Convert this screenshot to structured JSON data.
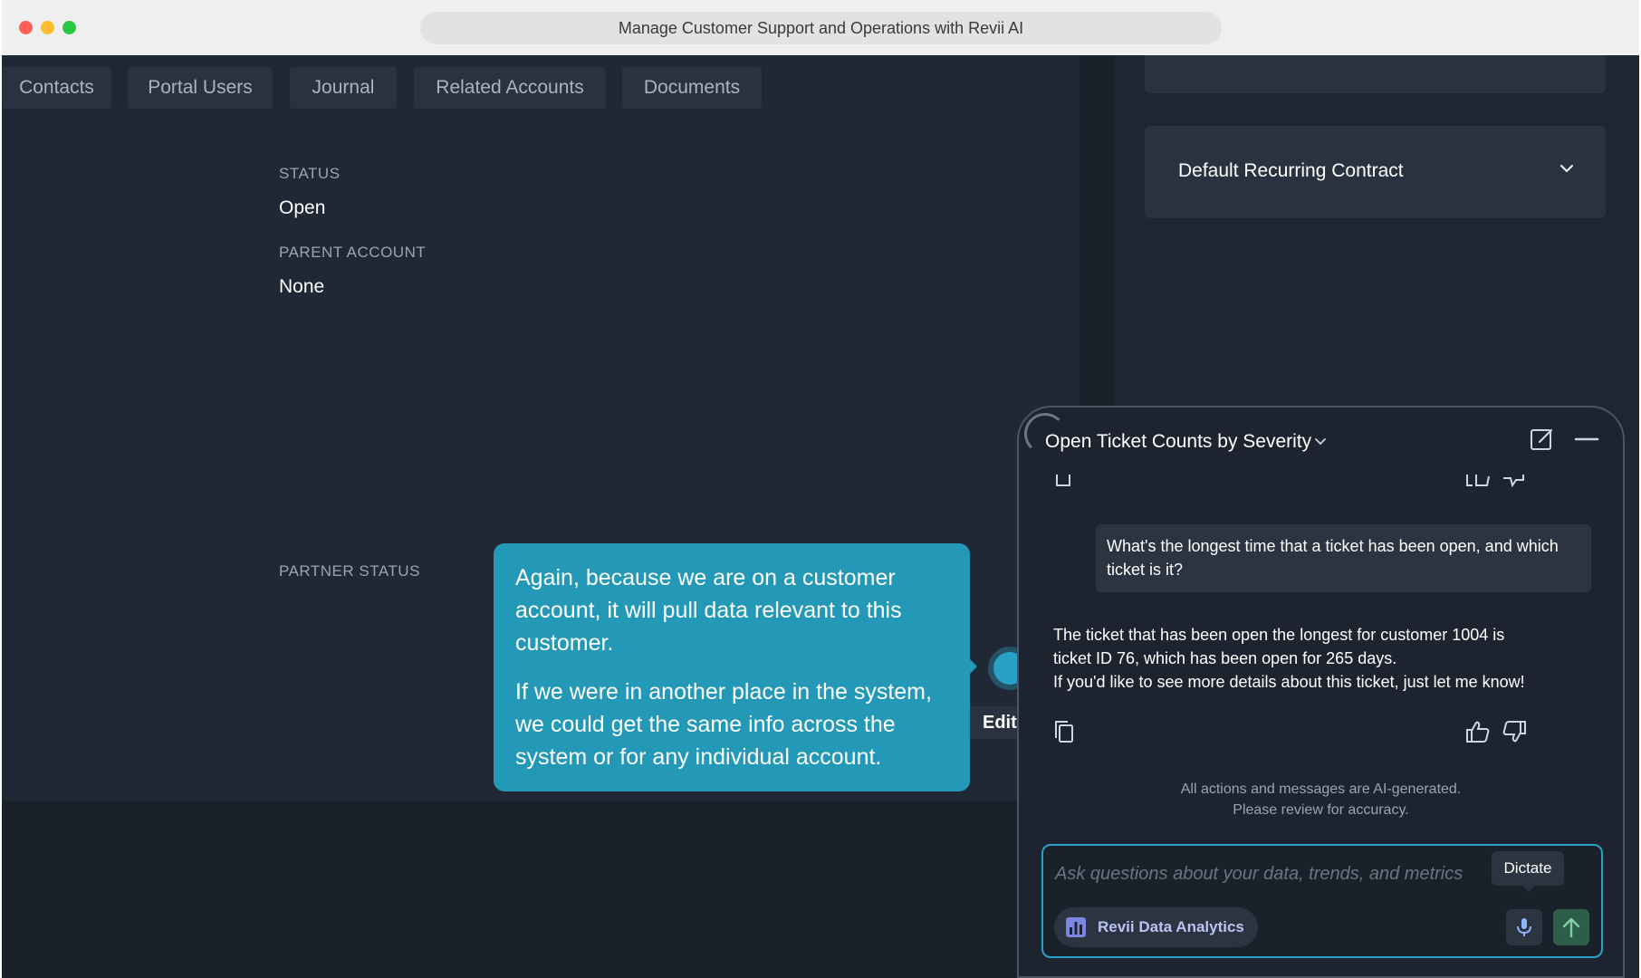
{
  "browser": {
    "title": "Manage Customer Support and Operations with Revii AI"
  },
  "tabs": [
    "Contacts",
    "Portal Users",
    "Journal",
    "Related Accounts",
    "Documents"
  ],
  "fields": {
    "status_label": "STATUS",
    "status_value": "Open",
    "parent_label": "PARENT ACCOUNT",
    "parent_value": "None",
    "partner_label": "PARTNER STATUS"
  },
  "right_panel": {
    "contract_title": "Default Recurring Contract"
  },
  "walkthrough": {
    "paragraph1": "Again, because we are on a customer account, it will pull data relevant to this customer.",
    "paragraph2": "If we were in another place in the system, we could get the same info across the system or for any individual account."
  },
  "edit_button": "Edit",
  "chat": {
    "title": "Open Ticket Counts by Severity",
    "user_message": "What's the longest time that a ticket has been open, and which ticket is it?",
    "ai_message_line1": "The ticket that has been open the longest for customer 1004 is ticket ID 76, which has been open for 265 days.",
    "ai_message_line2": "If you'd like to see more details about this ticket, just let me know!",
    "disclaimer_line1": "All actions and messages are AI-generated.",
    "disclaimer_line2": "Please review for accuracy.",
    "input_placeholder": "Ask questions about your data, trends, and metrics",
    "tool_pill": "Revii Data Analytics",
    "dictate_tooltip": "Dictate"
  },
  "colors": {
    "accent": "#2ba0c7",
    "tooltip": "#2398b7"
  }
}
